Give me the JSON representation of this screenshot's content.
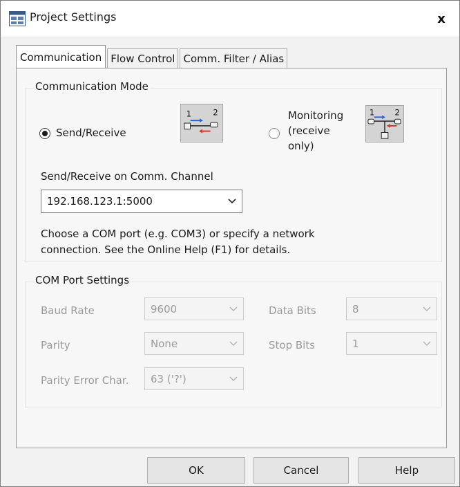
{
  "window": {
    "title": "Project Settings",
    "close_glyph": "x"
  },
  "tabs": [
    {
      "label": "Communication",
      "active": true
    },
    {
      "label": "Flow Control",
      "active": false
    },
    {
      "label": "Comm. Filter / Alias",
      "active": false
    }
  ],
  "communication_mode": {
    "group_label": "Communication Mode",
    "send_receive": {
      "label": "Send/Receive",
      "selected": true,
      "icon": "point-to-point-icon",
      "numbers": [
        "1",
        "2"
      ]
    },
    "monitoring": {
      "label_lines": [
        "Monitoring",
        "(receive",
        "only)"
      ],
      "selected": false,
      "icon": "tap-monitor-icon",
      "numbers": [
        "1",
        "2"
      ]
    },
    "channel_label": "Send/Receive on Comm. Channel",
    "channel_value": "192.168.123.1:5000",
    "help_lines": [
      "Choose a COM port (e.g. COM3) or specify a network",
      "connection. See the Online Help (F1) for details."
    ]
  },
  "com_port_settings": {
    "group_label": "COM Port Settings",
    "baud_rate": {
      "label": "Baud Rate",
      "value": "9600"
    },
    "data_bits": {
      "label": "Data Bits",
      "value": "8"
    },
    "parity": {
      "label": "Parity",
      "value": "None"
    },
    "stop_bits": {
      "label": "Stop Bits",
      "value": "1"
    },
    "parity_error_char": {
      "label": "Parity Error Char.",
      "value": "63 ('?')"
    }
  },
  "buttons": {
    "ok": "OK",
    "cancel": "Cancel",
    "help": "Help"
  },
  "colors": {
    "arrow_blue": "#2b5fd9",
    "arrow_red": "#d9302b",
    "disabled_text": "#9a9a9a"
  }
}
